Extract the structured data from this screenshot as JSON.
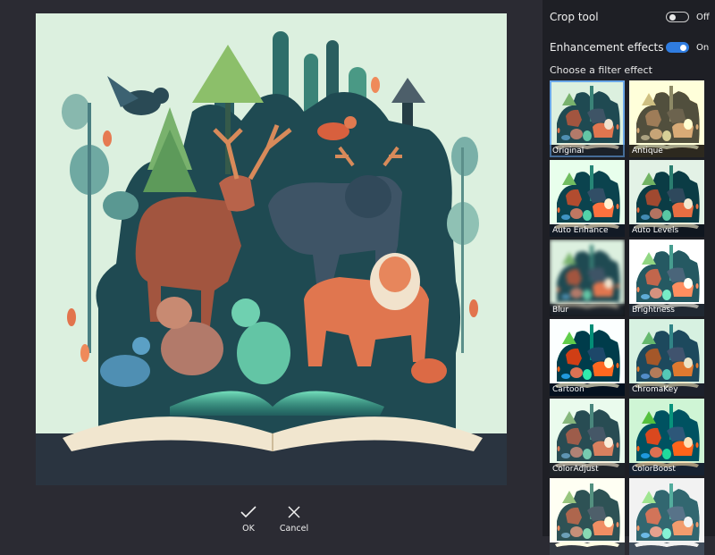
{
  "toolbar": {
    "ok_label": "OK",
    "cancel_label": "Cancel"
  },
  "panel": {
    "crop": {
      "label": "Crop tool",
      "state": "Off",
      "on": false
    },
    "enhance": {
      "label": "Enhancement effects",
      "state": "On",
      "on": true
    },
    "filters_label": "Choose a filter effect",
    "filters": [
      {
        "label": "Original",
        "selected": true
      },
      {
        "label": "Antique"
      },
      {
        "label": "Auto Enhance"
      },
      {
        "label": "Auto Levels"
      },
      {
        "label": "Blur"
      },
      {
        "label": "Brightness"
      },
      {
        "label": "Cartoon"
      },
      {
        "label": "ChromaKey"
      },
      {
        "label": "ColorAdjust"
      },
      {
        "label": "ColorBoost"
      },
      {
        "label": ""
      },
      {
        "label": ""
      }
    ]
  },
  "colors": {
    "accent": "#2f7ce0",
    "panel_bg": "#1e1f25",
    "workspace_bg": "#2b2b33",
    "selection": "#6aa7e8"
  }
}
